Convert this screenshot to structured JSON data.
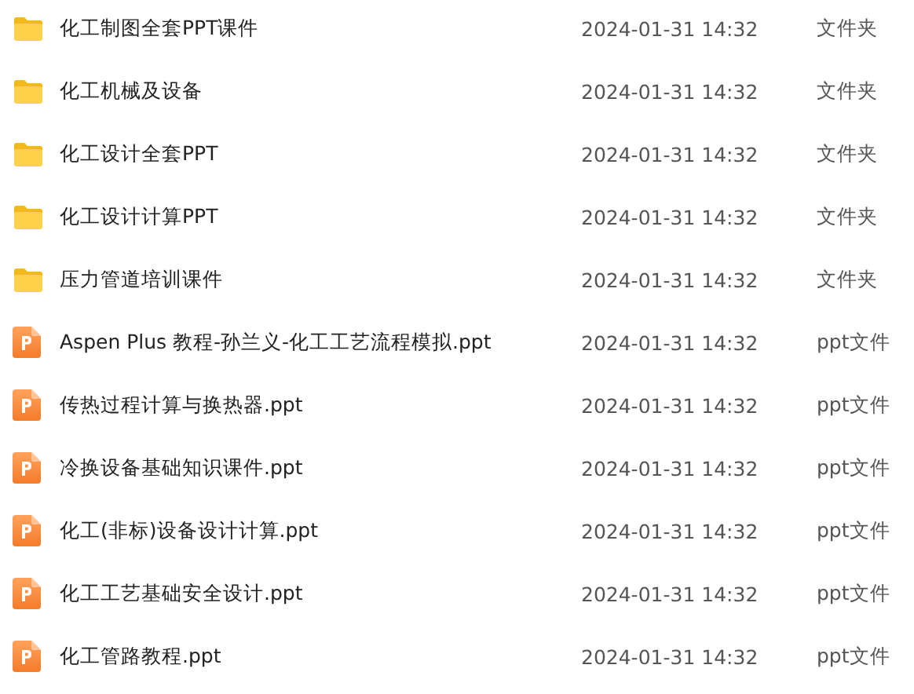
{
  "files": [
    {
      "kind": "folder",
      "name": "化工制图全套PPT课件",
      "modified": "2024-01-31 14:32",
      "type": "文件夹"
    },
    {
      "kind": "folder",
      "name": "化工机械及设备",
      "modified": "2024-01-31 14:32",
      "type": "文件夹"
    },
    {
      "kind": "folder",
      "name": "化工设计全套PPT",
      "modified": "2024-01-31 14:32",
      "type": "文件夹"
    },
    {
      "kind": "folder",
      "name": "化工设计计算PPT",
      "modified": "2024-01-31 14:32",
      "type": "文件夹"
    },
    {
      "kind": "folder",
      "name": "压力管道培训课件",
      "modified": "2024-01-31 14:32",
      "type": "文件夹"
    },
    {
      "kind": "ppt",
      "name": "Aspen Plus 教程-孙兰义-化工工艺流程模拟.ppt",
      "modified": "2024-01-31 14:32",
      "type": "ppt文件"
    },
    {
      "kind": "ppt",
      "name": "传热过程计算与换热器.ppt",
      "modified": "2024-01-31 14:32",
      "type": "ppt文件"
    },
    {
      "kind": "ppt",
      "name": "冷换设备基础知识课件.ppt",
      "modified": "2024-01-31 14:32",
      "type": "ppt文件"
    },
    {
      "kind": "ppt",
      "name": "化工(非标)设备设计计算.ppt",
      "modified": "2024-01-31 14:32",
      "type": "ppt文件"
    },
    {
      "kind": "ppt",
      "name": "化工工艺基础安全设计.ppt",
      "modified": "2024-01-31 14:32",
      "type": "ppt文件"
    },
    {
      "kind": "ppt",
      "name": "化工管路教程.ppt",
      "modified": "2024-01-31 14:32",
      "type": "ppt文件"
    }
  ]
}
